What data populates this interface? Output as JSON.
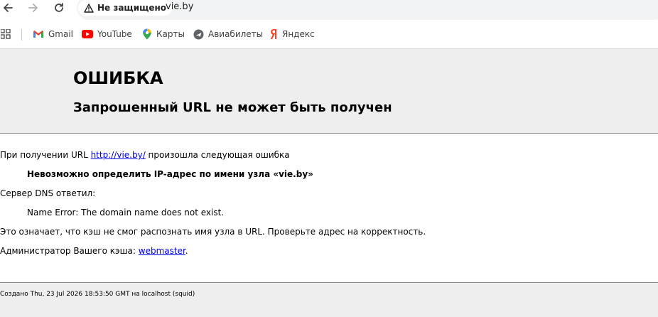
{
  "browser": {
    "security_label": "Не защищено",
    "url": "vie.by",
    "bookmarks": [
      {
        "label": "Gmail",
        "icon": "gmail-icon"
      },
      {
        "label": "YouTube",
        "icon": "youtube-icon"
      },
      {
        "label": "Карты",
        "icon": "maps-icon"
      },
      {
        "label": "Авиабилеты",
        "icon": "flights-icon"
      },
      {
        "label": "Яндекс",
        "icon": "yandex-icon"
      }
    ]
  },
  "page": {
    "title": "ОШИБКА",
    "subtitle": "Запрошенный URL не может быть получен",
    "intro_before": "При получении URL ",
    "intro_link": "http://vie.by/",
    "intro_after": " произошла следующая ошибка",
    "error_message": "Невозможно определить IP-адрес по имени узла «vie.by»",
    "dns_label": "Сервер DNS ответил:",
    "dns_reply": "Name Error: The domain name does not exist.",
    "explanation": "Это означает, что кэш не смог распознать имя узла в URL. Проверьте адрес на корректность.",
    "admin_before": "Администратор Вашего кэша: ",
    "admin_link": "webmaster",
    "admin_after": ".",
    "footer": "Создано Thu, 23 Jul 2026 18:53:50 GMT на localhost (squid)"
  }
}
